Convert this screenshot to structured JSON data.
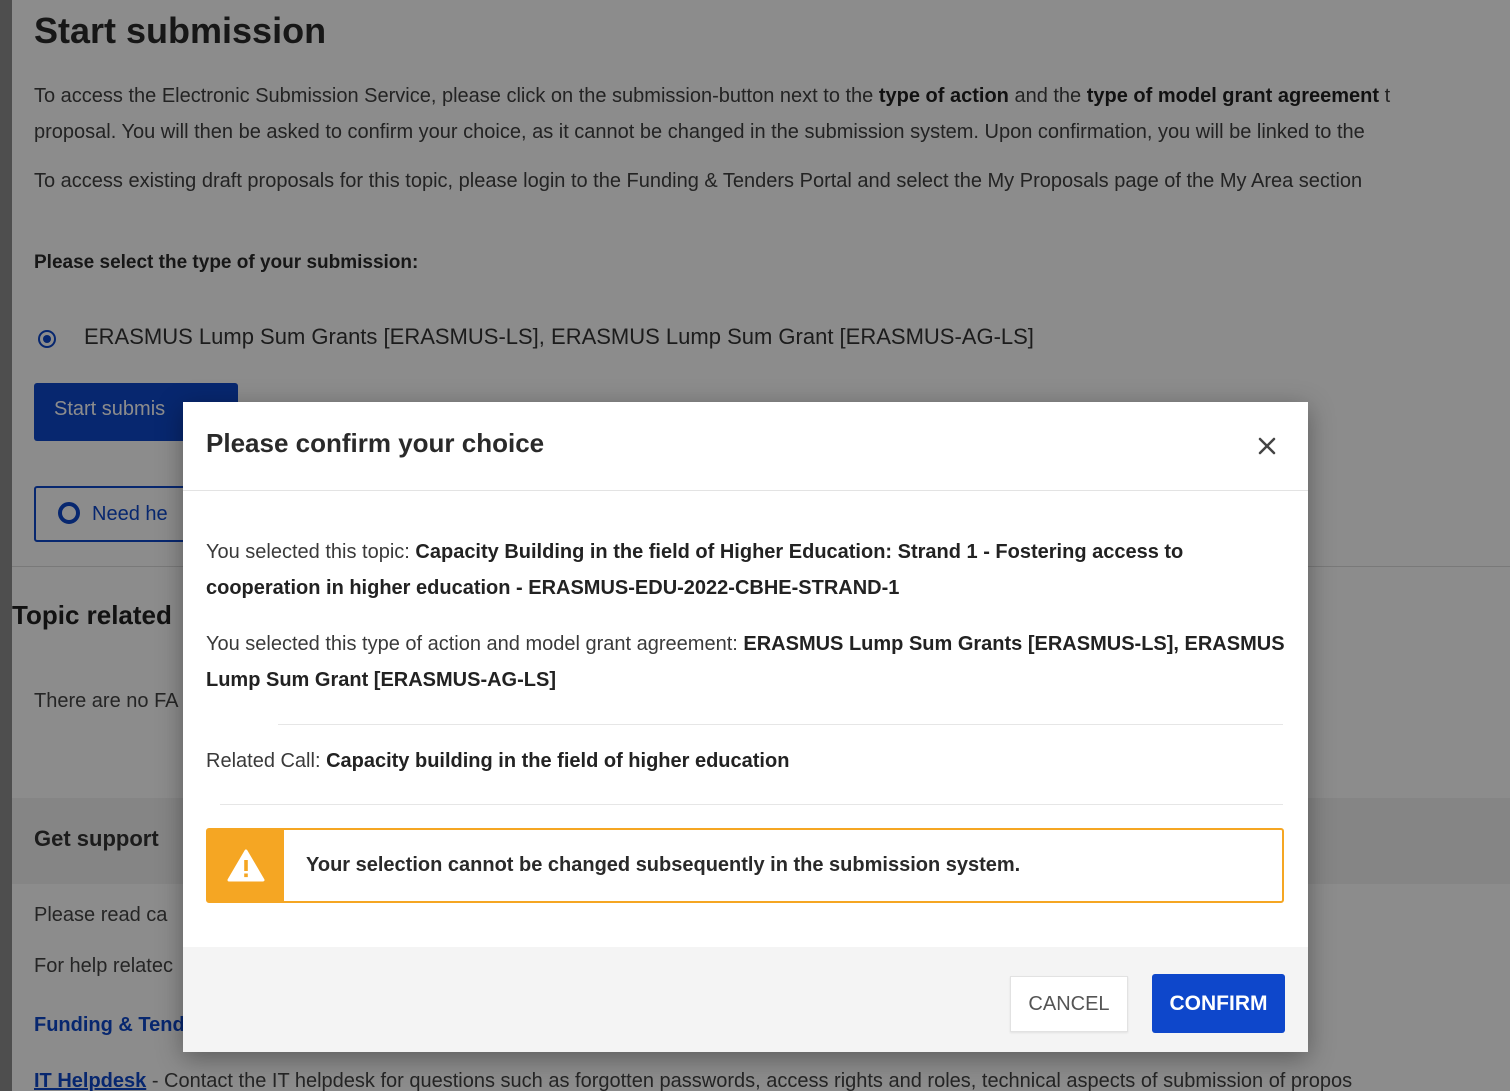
{
  "page": {
    "title": "Start submission",
    "intro": {
      "part1": "To access the Electronic Submission Service, please click on the submission-button next to the ",
      "bold1": "type of action",
      "part2": " and the ",
      "bold2": "type of model grant agreement",
      "part3": " t",
      "line2": "proposal. You will then be asked to confirm your choice, as it cannot be changed in the submission system. Upon confirmation, you will be linked to the"
    },
    "drafts_text": "To access existing draft proposals for this topic, please login to the Funding & Tenders Portal and select the My Proposals page of the My Area section",
    "select_label": "Please select the type of your submission:",
    "radio_option": "ERASMUS Lump Sum Grants [ERASMUS-LS], ERASMUS Lump Sum Grant [ERASMUS-AG-LS]",
    "start_button": "Start submis",
    "help_button": "Need he",
    "topic_related": "Topic related",
    "faq_text": "There are no FA",
    "get_support": "Get support",
    "read_carefully": "Please read ca",
    "help_related": "For help relatec",
    "ft_link": "Funding & Tend",
    "it_helpdesk_link": "IT Helpdesk",
    "it_helpdesk_text": " - Contact the IT helpdesk for questions such as forgotten passwords, access rights and roles, technical aspects of submission of propos"
  },
  "modal": {
    "title": "Please confirm your choice",
    "topic_prefix": "You selected this topic: ",
    "topic_value": "Capacity Building in the field of Higher Education: Strand 1 - Fostering access to cooperation in higher education - ERASMUS-EDU-2022-CBHE-STRAND-1",
    "action_prefix": "You selected this type of action and model grant agreement: ",
    "action_value": "ERASMUS Lump Sum Grants [ERASMUS-LS], ERASMUS Lump Sum Grant [ERASMUS-AG-LS]",
    "call_prefix": "Related Call: ",
    "call_value": "Capacity building in the field of higher education",
    "warning": "Your selection cannot be changed subsequently in the submission system.",
    "cancel_label": "CANCEL",
    "confirm_label": "CONFIRM"
  },
  "icons": {
    "close": "close-icon",
    "warning": "warning-icon",
    "help": "lifebuoy-icon"
  },
  "colors": {
    "primary": "#0e47cb",
    "warning": "#f5a623",
    "overlay": "rgba(0,0,0,0.45)"
  }
}
